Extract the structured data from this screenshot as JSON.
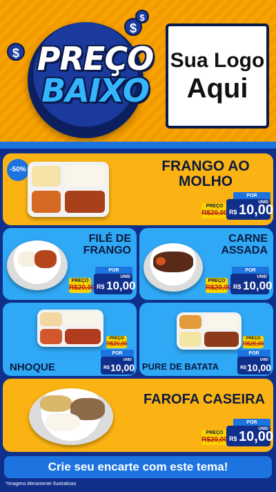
{
  "brand": {
    "line1": "PREÇO",
    "line2": "BAIXO",
    "dollar_sign": "$"
  },
  "logo_box": {
    "line1": "Sua Logo",
    "line2": "Aqui"
  },
  "products": [
    {
      "name_l1": "FRANGO AO",
      "name_l2": "MOLHO",
      "badge": "-50%",
      "old_label": "PREÇO",
      "old_price": "R$20,00",
      "por": "POR",
      "currency": "R$",
      "price": "10,00",
      "unit": "UNID"
    },
    {
      "name_l1": "FILÉ DE",
      "name_l2": "FRANGO",
      "old_label": "PREÇO",
      "old_price": "R$20,00",
      "por": "POR",
      "currency": "R$",
      "price": "10,00",
      "unit": "UNID"
    },
    {
      "name_l1": "CARNE",
      "name_l2": "ASSADA",
      "old_label": "PREÇO",
      "old_price": "R$20,00",
      "por": "POR",
      "currency": "R$",
      "price": "10,00",
      "unit": "UNID"
    },
    {
      "name_l1": "NHOQUE",
      "old_label": "PREÇO",
      "old_price": "R$20,00",
      "por": "POR",
      "currency": "R$",
      "price": "10,00",
      "unit": "UNID"
    },
    {
      "name_l1": "PURE DE BATATA",
      "old_label": "PREÇO",
      "old_price": "R$20,00",
      "por": "POR",
      "currency": "R$",
      "price": "10,00",
      "unit": "UNID"
    },
    {
      "name_l1": "FAROFA CASEIRA",
      "old_label": "PREÇO",
      "old_price": "R$20,00",
      "por": "POR",
      "currency": "R$",
      "price": "10,00",
      "unit": "UNID"
    }
  ],
  "cta": "Crie seu encarte com este tema!",
  "disclaimer": "*Imagens Meramente Ilustrativas",
  "colors": {
    "orange": "#f7a300",
    "yellow_card": "#fbb313",
    "blue_card": "#2fa8f5",
    "navy": "#0f2f8a",
    "accent_blue": "#1d74e0"
  }
}
